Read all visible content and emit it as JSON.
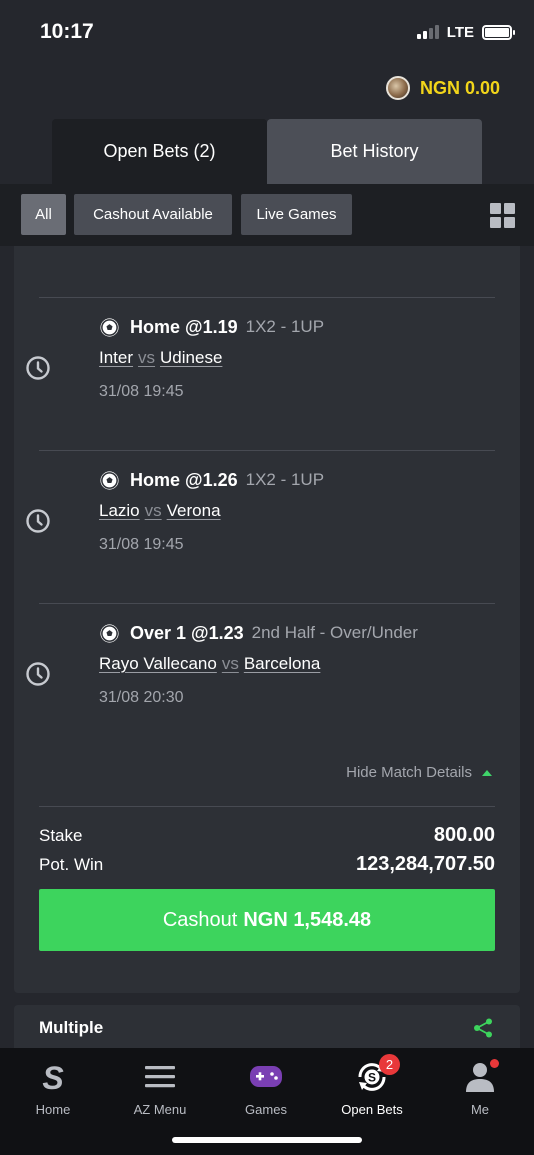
{
  "status_bar": {
    "time": "10:17",
    "network": "LTE"
  },
  "balance": {
    "text": "NGN 0.00"
  },
  "tabs": [
    {
      "label": "Open Bets (2)",
      "active": true
    },
    {
      "label": "Bet History",
      "active": false
    }
  ],
  "filters": [
    {
      "label": "All",
      "active": true
    },
    {
      "label": "Cashout Available",
      "active": false
    },
    {
      "label": "Live Games",
      "active": false
    }
  ],
  "selections": [
    {
      "pick": "Home @1.19",
      "market": "1X2  -  1UP",
      "home": "Inter",
      "vs": "vs",
      "away": "Udinese",
      "datetime": "31/08 19:45",
      "icon": "clock-icon"
    },
    {
      "pick": "Home @1.26",
      "market": "1X2  -  1UP",
      "home": "Lazio",
      "vs": "vs",
      "away": "Verona",
      "datetime": "31/08 19:45",
      "icon": "clock-icon"
    },
    {
      "pick": "Over 1 @1.23",
      "market": "2nd Half  -  Over/Under",
      "home": "Rayo Vallecano",
      "vs": "vs",
      "away": "Barcelona",
      "datetime": "31/08 20:30",
      "icon": "clock-icon"
    }
  ],
  "hide_details_label": "Hide Match Details",
  "summary": {
    "stake_label": "Stake",
    "stake_value": "800.00",
    "potwin_label": "Pot. Win",
    "potwin_value": "123,284,707.50"
  },
  "cashout": {
    "prefix": "Cashout",
    "amount": "NGN 1,548.48"
  },
  "next_card": {
    "title": "Multiple"
  },
  "bottom_nav": [
    {
      "label": "Home",
      "icon": "sporty-logo-icon"
    },
    {
      "label": "AZ Menu",
      "icon": "hamburger-menu-icon"
    },
    {
      "label": "Games",
      "icon": "gamepad-icon"
    },
    {
      "label": "Open Bets",
      "icon": "open-bets-icon",
      "badge": "2",
      "active": true
    },
    {
      "label": "Me",
      "icon": "user-icon"
    }
  ],
  "colors": {
    "accent_green": "#3dd45d",
    "balance_yellow": "#f2d51a",
    "badge_red": "#e8383a"
  }
}
